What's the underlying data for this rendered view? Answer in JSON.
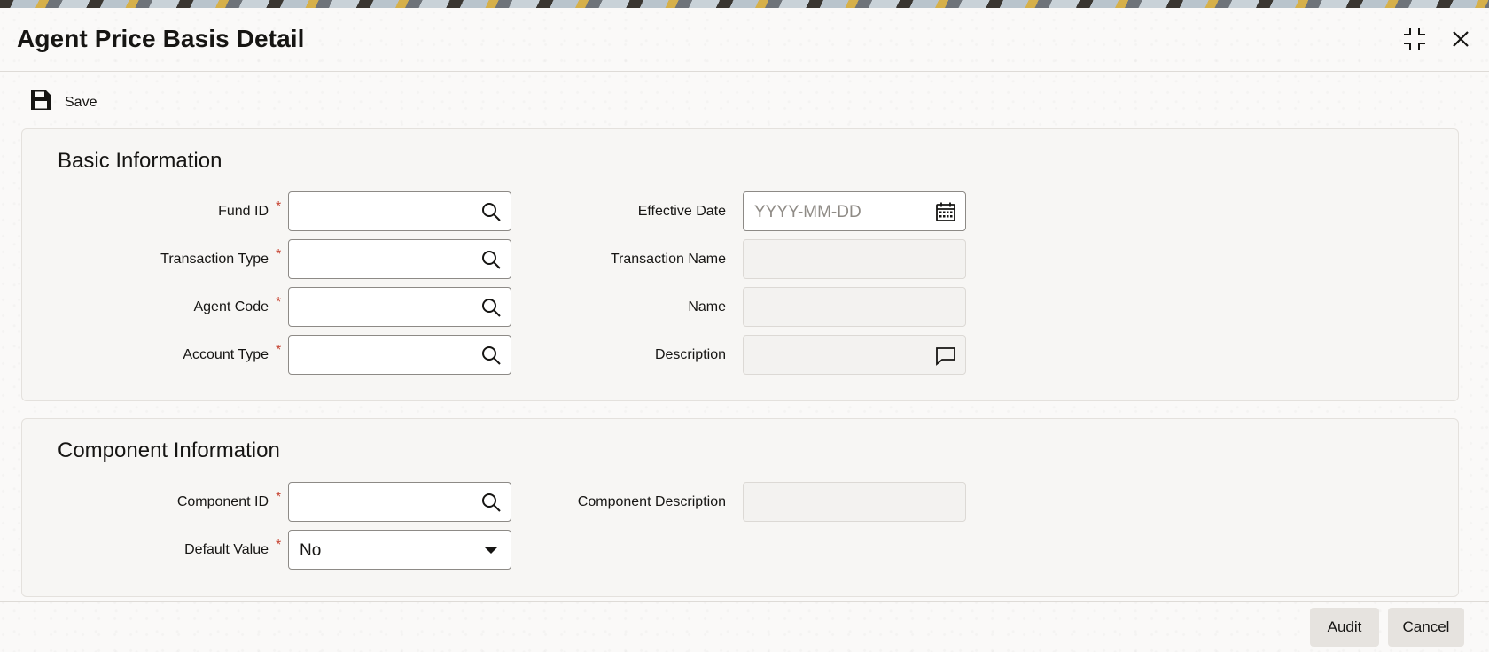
{
  "window": {
    "title": "Agent Price Basis Detail"
  },
  "toolbar": {
    "save_label": "Save"
  },
  "basic": {
    "heading": "Basic Information",
    "fund_id": {
      "label": "Fund ID",
      "value": ""
    },
    "transaction_type": {
      "label": "Transaction Type",
      "value": ""
    },
    "agent_code": {
      "label": "Agent Code",
      "value": ""
    },
    "account_type": {
      "label": "Account Type",
      "value": ""
    },
    "effective_date": {
      "label": "Effective Date",
      "placeholder": "YYYY-MM-DD"
    },
    "transaction_name": {
      "label": "Transaction Name",
      "value": ""
    },
    "name": {
      "label": "Name",
      "value": ""
    },
    "description": {
      "label": "Description",
      "value": ""
    },
    "required_mark": "*"
  },
  "component": {
    "heading": "Component Information",
    "component_id": {
      "label": "Component ID",
      "value": ""
    },
    "default_value": {
      "label": "Default Value",
      "value": "No"
    },
    "component_description": {
      "label": "Component Description",
      "value": ""
    }
  },
  "footer": {
    "audit_label": "Audit",
    "cancel_label": "Cancel"
  },
  "icons": [
    "maximize-icon",
    "close-icon",
    "save-icon",
    "search-icon",
    "calendar-icon",
    "comment-icon",
    "chevron-down-icon"
  ]
}
